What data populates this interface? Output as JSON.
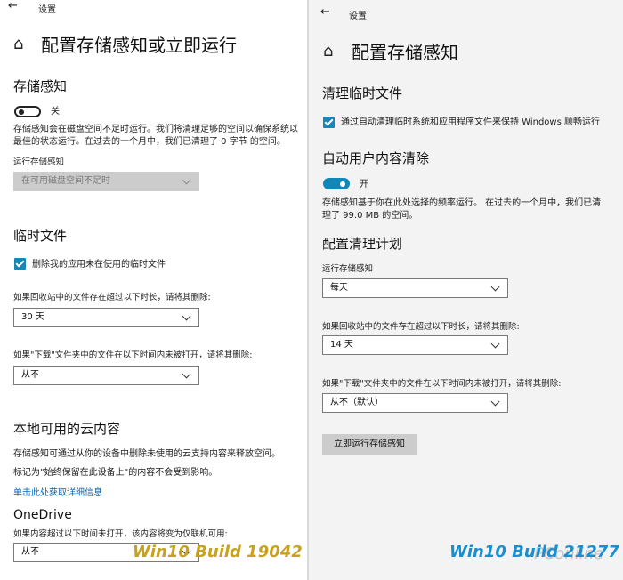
{
  "left": {
    "nav_title": "设置",
    "page_title": "配置存储感知或立即运行",
    "storage_sense": {
      "heading": "存储感知",
      "toggle_state": "关",
      "description_line1": "存储感知会在磁盘空间不足时运行。我们将清理足够的空间以确保系统以",
      "description_line2": "最佳的状态运行。在过去的一个月中，我们已清理了 0 字节 的空间。",
      "run_label": "运行存储感知",
      "run_value": "在可用磁盘空间不足时"
    },
    "temp_files": {
      "heading": "临时文件",
      "checkbox_label": "删除我的应用未在使用的临时文件",
      "recycle_label": "如果回收站中的文件存在超过以下时长，请将其删除:",
      "recycle_value": "30 天",
      "downloads_label": "如果\"下载\"文件夹中的文件在以下时间内未被打开，请将其删除:",
      "downloads_value": "从不"
    },
    "cloud": {
      "heading": "本地可用的云内容",
      "description": "存储感知可通过从你的设备中删除未使用的云支持内容来释放空间。",
      "note": "标记为\"始终保留在此设备上\"的内容不会受到影响。",
      "link": "单击此处获取详细信息",
      "onedrive_heading": "OneDrive",
      "onedrive_label": "如果内容超过以下时间未打开，该内容将变为仅联机可用:",
      "onedrive_value": "从不"
    },
    "caption": "Win10 Build 19042"
  },
  "right": {
    "nav_title": "设置",
    "page_title": "配置存储感知",
    "temp_files": {
      "heading": "清理临时文件",
      "checkbox_label": "通过自动清理临时系统和应用程序文件来保持 Windows 顺畅运行"
    },
    "user_content": {
      "heading": "自动用户内容清除",
      "toggle_state": "开",
      "description_line1": "存储感知基于你在此处选择的频率运行。 在过去的一个月中，我们已清",
      "description_line2": "理了 99.0 MB 的空间。"
    },
    "schedule": {
      "heading": "配置清理计划",
      "run_label": "运行存储感知",
      "run_value": "每天",
      "recycle_label": "如果回收站中的文件存在超过以下时长，请将其删除:",
      "recycle_value": "14 天",
      "downloads_label": "如果\"下载\"文件夹中的文件在以下时间内未被打开，请将其删除:",
      "downloads_value": "从不（默认）",
      "run_now_button": "立即运行存储感知"
    },
    "caption": "Win10 Build 21277",
    "watermark": "PConline"
  },
  "colors": {
    "accent": "#0f87b9",
    "link": "#0067c0",
    "caption_left": "#c8a21e",
    "caption_right": "#1a8fd0"
  },
  "icons": {
    "back": "arrow-left-icon",
    "home": "home-icon",
    "dropdown": "chevron-down-icon",
    "checkbox": "checkmark-icon"
  }
}
